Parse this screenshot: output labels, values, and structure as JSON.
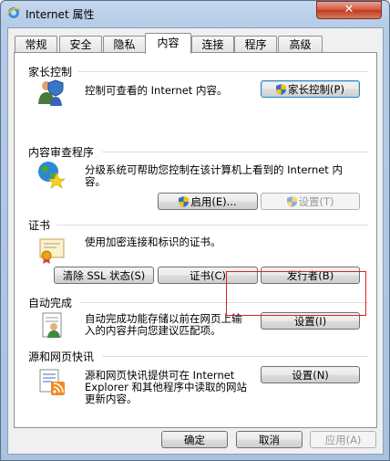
{
  "window": {
    "title": "Internet 属性",
    "close_glyph": "✕"
  },
  "tabs": [
    {
      "label": "常规"
    },
    {
      "label": "安全"
    },
    {
      "label": "隐私"
    },
    {
      "label": "内容"
    },
    {
      "label": "连接"
    },
    {
      "label": "程序"
    },
    {
      "label": "高级"
    }
  ],
  "active_tab": "内容",
  "parental": {
    "title": "家长控制",
    "desc": "控制可查看的 Internet 内容。",
    "button": "家长控制(P)"
  },
  "advisor": {
    "title": "内容审查程序",
    "desc_line1": "分级系统可帮助您控制在该计算机上看到的 Internet 内",
    "desc_line2": "容。",
    "enable_button": "启用(E)...",
    "settings_button": "设置(T)"
  },
  "certificates": {
    "title": "证书",
    "desc": "使用加密连接和标识的证书。",
    "clear_ssl_button": "清除 SSL 状态(S)",
    "certs_button": "证书(C)",
    "publishers_button": "发行者(B)"
  },
  "autocomplete": {
    "title": "自动完成",
    "desc_line1": "自动完成功能存储以前在网页上输",
    "desc_line2": "入的内容并向您建议匹配项。",
    "settings_button": "设置(I)"
  },
  "feeds": {
    "title": "源和网页快讯",
    "desc_line1": "源和网页快讯提供可在 Internet",
    "desc_line2": "Explorer 和其他程序中读取的网站",
    "desc_line3": "更新内容。",
    "settings_button": "设置(N)"
  },
  "footer": {
    "ok_button": "确定",
    "cancel_button": "取消",
    "apply_button": "应用(A)"
  },
  "colors": {
    "highlight": "#e02020",
    "accent_blue": "#3c7fb1"
  }
}
